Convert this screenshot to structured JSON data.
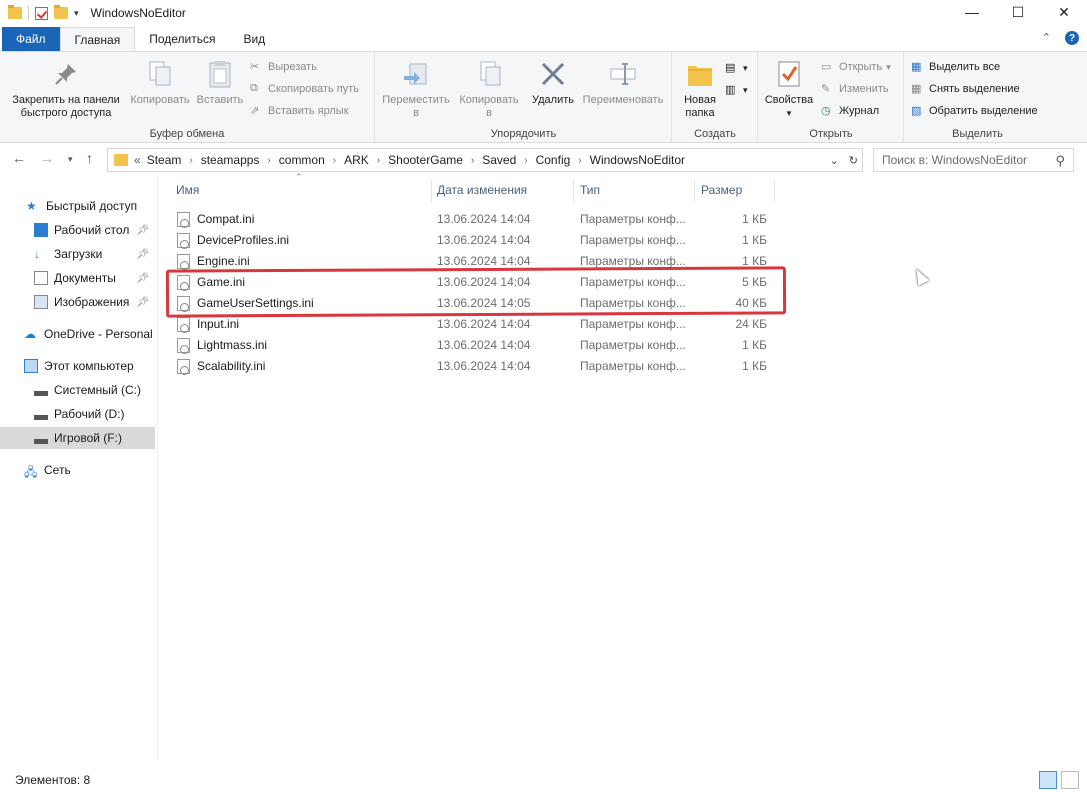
{
  "window": {
    "title": "WindowsNoEditor",
    "controls": {
      "minimize": "—",
      "maximize": "☐",
      "close": "✕"
    }
  },
  "ribbon_tabs": [
    {
      "label": "Файл"
    },
    {
      "label": "Главная"
    },
    {
      "label": "Поделиться"
    },
    {
      "label": "Вид"
    }
  ],
  "ribbon": {
    "clipboard": {
      "pin_label_1": "Закрепить на панели",
      "pin_label_2": "быстрого доступа",
      "copy": "Копировать",
      "paste": "Вставить",
      "cut": "Вырезать",
      "copy_path": "Скопировать путь",
      "paste_shortcut": "Вставить ярлык",
      "group": "Буфер обмена"
    },
    "organize": {
      "move_1": "Переместить",
      "move_2": "в",
      "copy_1": "Копировать",
      "copy_2": "в",
      "delete": "Удалить",
      "rename": "Переименовать",
      "group": "Упорядочить"
    },
    "create": {
      "new_folder_1": "Новая",
      "new_folder_2": "папка",
      "group": "Создать"
    },
    "open": {
      "properties": "Свойства",
      "open": "Открыть",
      "edit": "Изменить",
      "history": "Журнал",
      "group": "Открыть"
    },
    "select": {
      "select_all": "Выделить все",
      "select_none": "Снять выделение",
      "invert": "Обратить выделение",
      "group": "Выделить"
    }
  },
  "address": {
    "overflow": "«",
    "crumbs": [
      "Steam",
      "steamapps",
      "common",
      "ARK",
      "ShooterGame",
      "Saved",
      "Config",
      "WindowsNoEditor"
    ],
    "search_placeholder": "Поиск в: WindowsNoEditor"
  },
  "nav": {
    "quick_access": "Быстрый доступ",
    "desktop": "Рабочий стол",
    "downloads": "Загрузки",
    "documents": "Документы",
    "pictures": "Изображения",
    "onedrive": "OneDrive - Personal",
    "this_pc": "Этот компьютер",
    "drive_c": "Системный (C:)",
    "drive_d": "Рабочий (D:)",
    "drive_f": "Игровой (F:)",
    "network": "Сеть"
  },
  "columns": {
    "name": "Имя",
    "date": "Дата изменения",
    "type": "Тип",
    "size": "Размер"
  },
  "files": [
    {
      "name": "Compat.ini",
      "date": "13.06.2024 14:04",
      "type": "Параметры конф...",
      "size": "1 КБ"
    },
    {
      "name": "DeviceProfiles.ini",
      "date": "13.06.2024 14:04",
      "type": "Параметры конф...",
      "size": "1 КБ"
    },
    {
      "name": "Engine.ini",
      "date": "13.06.2024 14:04",
      "type": "Параметры конф...",
      "size": "1 КБ"
    },
    {
      "name": "Game.ini",
      "date": "13.06.2024 14:04",
      "type": "Параметры конф...",
      "size": "5 КБ"
    },
    {
      "name": "GameUserSettings.ini",
      "date": "13.06.2024 14:05",
      "type": "Параметры конф...",
      "size": "40 КБ"
    },
    {
      "name": "Input.ini",
      "date": "13.06.2024 14:04",
      "type": "Параметры конф...",
      "size": "24 КБ"
    },
    {
      "name": "Lightmass.ini",
      "date": "13.06.2024 14:04",
      "type": "Параметры конф...",
      "size": "1 КБ"
    },
    {
      "name": "Scalability.ini",
      "date": "13.06.2024 14:04",
      "type": "Параметры конф...",
      "size": "1 КБ"
    }
  ],
  "status": {
    "items": "Элементов: 8"
  },
  "colors": {
    "accent": "#1a65b8",
    "annotation": "#d8373f"
  }
}
